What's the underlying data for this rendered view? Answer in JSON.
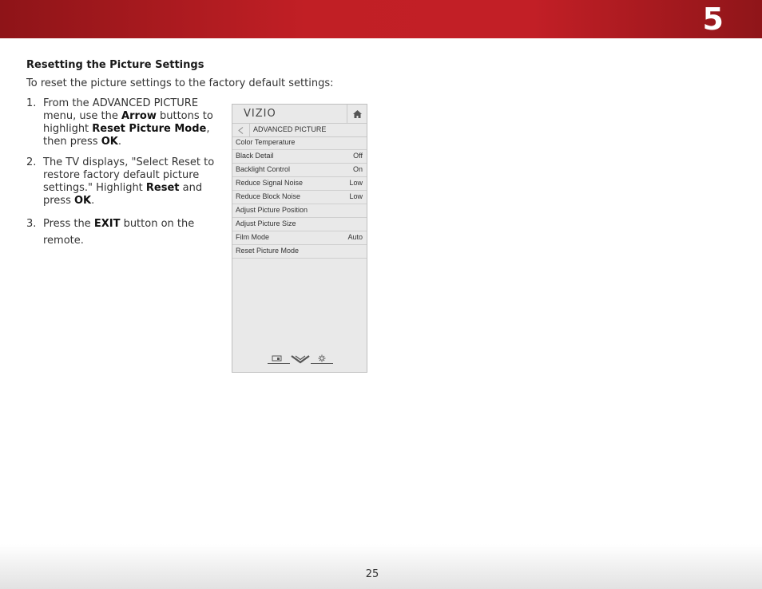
{
  "header": {
    "chapter_number": "5"
  },
  "section": {
    "title": "Resetting the Picture Settings",
    "intro": "To reset the picture settings to the factory default settings:"
  },
  "steps": [
    {
      "num": "1.",
      "parts": [
        "From the ADVANCED PICTURE menu, use the ",
        "Arrow",
        " buttons to highlight ",
        "Reset Picture Mode",
        ", then press ",
        "OK",
        "."
      ]
    },
    {
      "num": "2.",
      "parts": [
        "The TV displays, \"Select Reset to restore factory default picture settings.\" Highlight ",
        "Reset",
        " and press ",
        "OK",
        "."
      ]
    },
    {
      "num": "3.",
      "parts": [
        "Press the ",
        "EXIT",
        " button on the remote."
      ]
    }
  ],
  "tv_menu": {
    "logo": "VIZIO",
    "breadcrumb": "ADVANCED PICTURE",
    "items": [
      {
        "label": "Color Temperature",
        "value": ""
      },
      {
        "label": "Black Detail",
        "value": "Off"
      },
      {
        "label": "Backlight Control",
        "value": "On"
      },
      {
        "label": "Reduce Signal Noise",
        "value": "Low"
      },
      {
        "label": "Reduce Block Noise",
        "value": "Low"
      },
      {
        "label": "Adjust Picture Position",
        "value": ""
      },
      {
        "label": "Adjust Picture Size",
        "value": ""
      },
      {
        "label": "Film Mode",
        "value": "Auto"
      },
      {
        "label": "Reset Picture Mode",
        "value": ""
      }
    ],
    "icons": [
      "home-icon",
      "back-arrow-icon",
      "input-icon",
      "vizio-v-icon",
      "settings-gear-icon"
    ]
  },
  "footer": {
    "page_number": "25"
  }
}
